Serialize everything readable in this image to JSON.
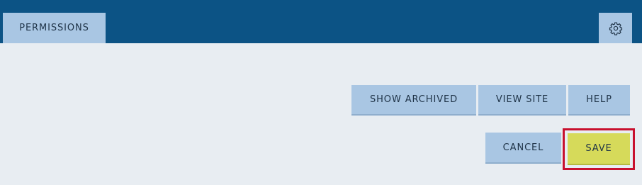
{
  "header": {
    "tab_label": "PERMISSIONS",
    "settings_icon": "gear-icon",
    "background_color": "#0c5385"
  },
  "actions": {
    "show_archived": "SHOW ARCHIVED",
    "view_site": "VIEW SITE",
    "help": "HELP",
    "cancel": "CANCEL",
    "save": "SAVE"
  },
  "colors": {
    "button": "#a9c6e3",
    "save_button": "#d6da5a",
    "highlight_border": "#c8102e",
    "content_background": "#e8edf2"
  }
}
